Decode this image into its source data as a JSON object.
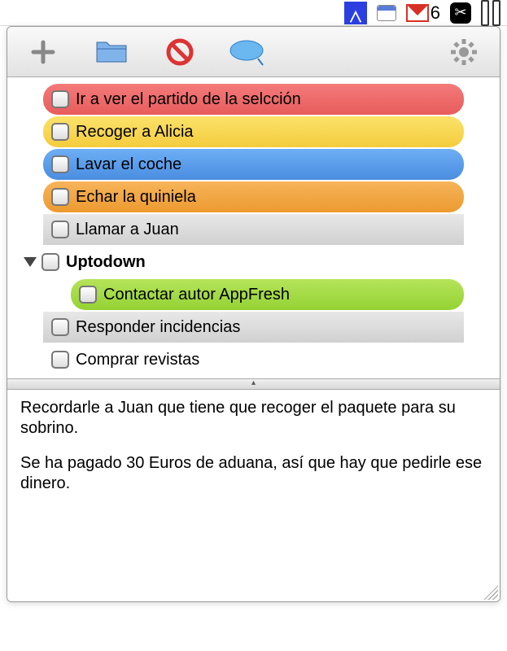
{
  "menubar": {
    "gmail_count": "6"
  },
  "toolbar": {
    "add": "add",
    "folder": "folder",
    "cancel": "cancel",
    "tag": "tag",
    "settings": "settings"
  },
  "tasks": [
    {
      "label": "Ir a ver el partido de la selcción",
      "color": "red"
    },
    {
      "label": "Recoger a Alicia",
      "color": "yellow"
    },
    {
      "label": "Lavar el coche",
      "color": "blue"
    },
    {
      "label": "Echar la quiniela",
      "color": "orange"
    },
    {
      "label": "Llamar a Juan",
      "color": "gray"
    }
  ],
  "group": {
    "label": "Uptodown",
    "children": [
      {
        "label": "Contactar autor AppFresh",
        "color": "green"
      },
      {
        "label": "Responder incidencias",
        "color": "gray"
      }
    ]
  },
  "tail_task": {
    "label": "Comprar revistas"
  },
  "notes": {
    "p1": "Recordarle a Juan que tiene que recoger el paquete para su sobrino.",
    "p2": "Se ha pagado 30 Euros de aduana, así que hay que pedirle ese dinero."
  }
}
